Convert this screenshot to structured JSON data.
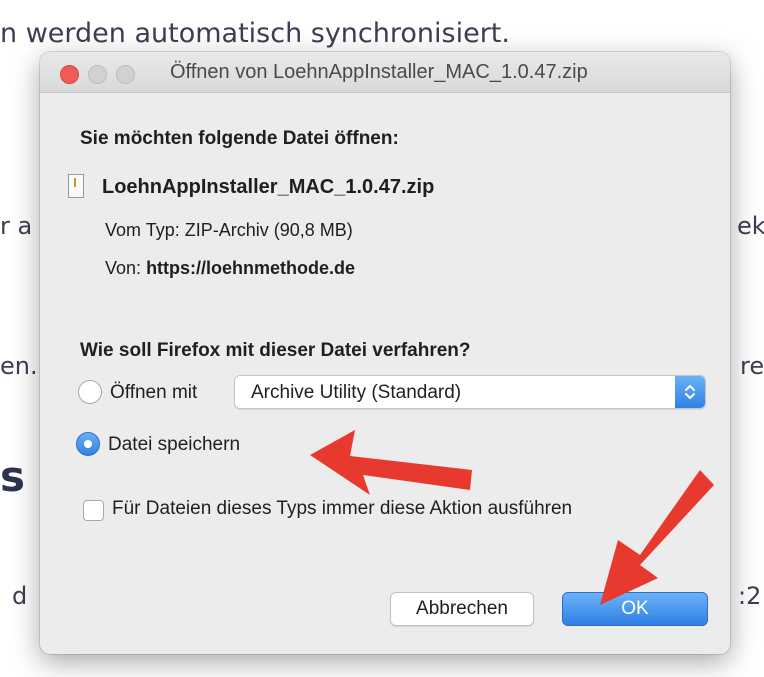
{
  "background": {
    "headline": "n werden automatisch synchronisiert.",
    "fragments": [
      "r a",
      "ek",
      "en.",
      "re",
      "s",
      "d",
      ":2"
    ]
  },
  "dialog": {
    "title": "Öffnen von LoehnAppInstaller_MAC_1.0.47.zip",
    "intro": "Sie möchten folgende Datei öffnen:",
    "file_name": "LoehnAppInstaller_MAC_1.0.47.zip",
    "type_label": "Vom Typ:",
    "type_value": "ZIP-Archiv (90,8 MB)",
    "from_label": "Von:",
    "from_value": "https://loehnmethode.de",
    "question": "Wie soll Firefox mit dieser Datei verfahren?",
    "option_open_label": "Öffnen mit",
    "open_with_app": "Archive Utility (Standard)",
    "option_save_label": "Datei speichern",
    "save_selected": true,
    "always_label": "Für Dateien dieses Typs immer diese Aktion ausführen",
    "always_checked": false,
    "cancel_label": "Abbrechen",
    "ok_label": "OK"
  },
  "colors": {
    "accent_blue": "#2f80e4",
    "arrow_red": "#e8392e",
    "close_red": "#ee5c55"
  },
  "icons": [
    "file-icon",
    "chevron-updown-icon",
    "arrow-annotation-icon"
  ]
}
